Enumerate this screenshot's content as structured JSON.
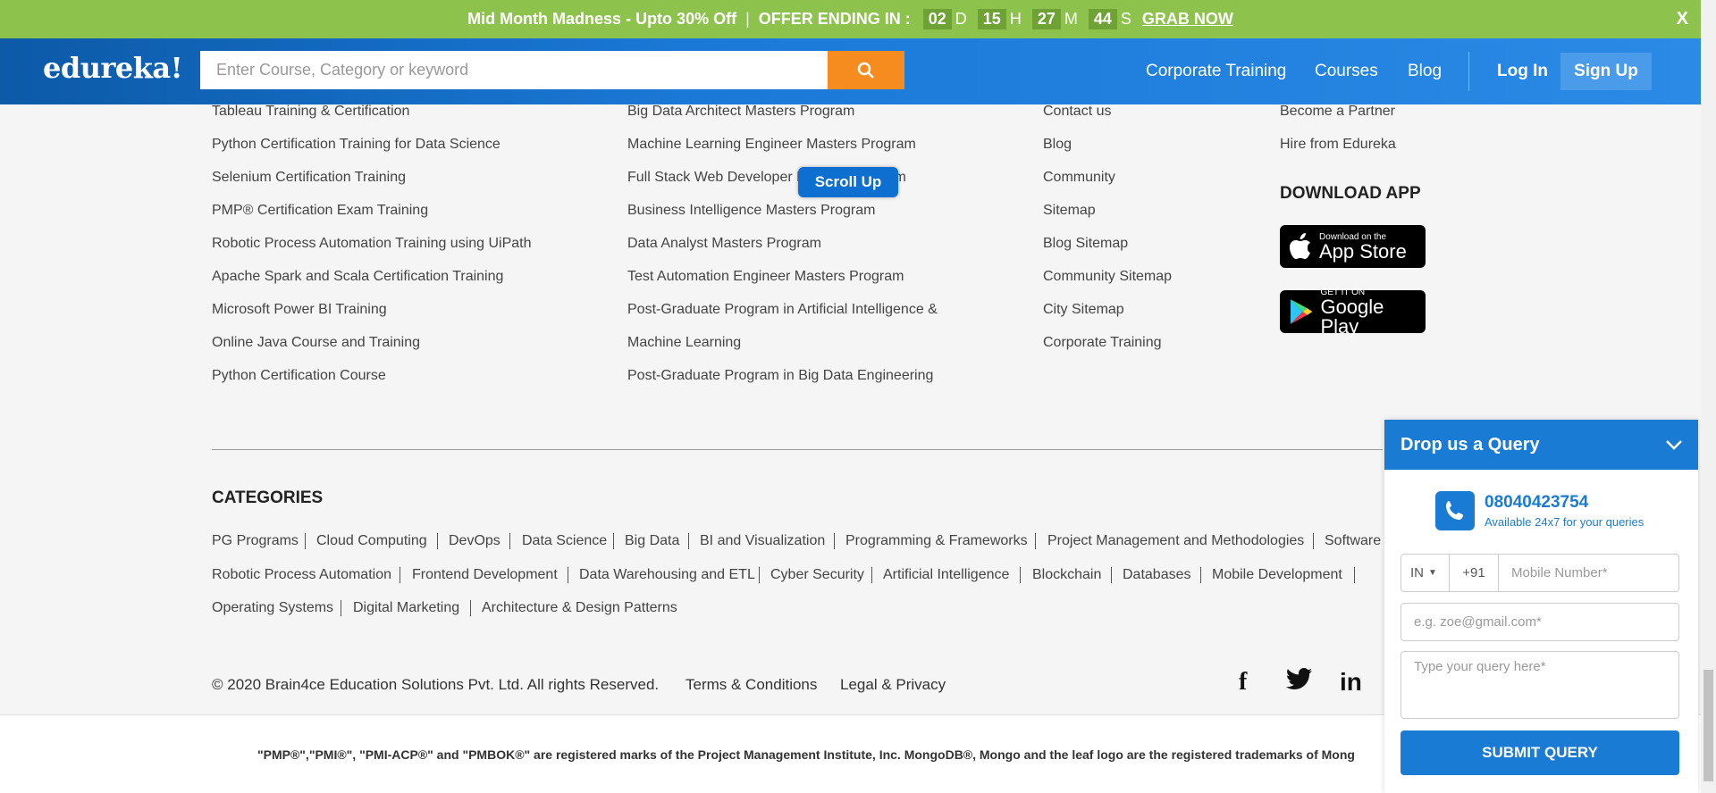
{
  "promo": {
    "text": "Mid Month Madness - Upto 30% Off",
    "offer_label": "OFFER ENDING IN :",
    "days": "02",
    "days_unit": "D",
    "hours": "15",
    "hours_unit": "H",
    "minutes": "27",
    "minutes_unit": "M",
    "seconds": "44",
    "seconds_unit": "S",
    "cta": "GRAB NOW",
    "close": "X"
  },
  "header": {
    "logo": "edureka!",
    "search_placeholder": "Enter Course, Category or keyword",
    "nav": [
      "Corporate Training",
      "Courses",
      "Blog"
    ],
    "login": "Log In",
    "signup": "Sign Up"
  },
  "footer": {
    "col1": [
      "Tableau Training & Certification",
      "Python Certification Training for Data Science",
      "Selenium Certification Training",
      "PMP® Certification Exam Training",
      "Robotic Process Automation Training using UiPath",
      "Apache Spark and Scala Certification Training",
      "Microsoft Power BI Training",
      "Online Java Course and Training",
      "Python Certification Course"
    ],
    "col2": [
      "Big Data Architect Masters Program",
      "Machine Learning Engineer Masters Program",
      "Full Stack Web Developer Masters Program",
      "Business Intelligence Masters Program",
      "Data Analyst Masters Program",
      "Test Automation Engineer Masters Program",
      "Post-Graduate Program in Artificial Intelligence &",
      "Machine Learning",
      "Post-Graduate Program in Big Data Engineering"
    ],
    "col3": [
      "Contact us",
      "Blog",
      "Community",
      "Sitemap",
      "Blog Sitemap",
      "Community Sitemap",
      "City Sitemap",
      "Corporate Training"
    ],
    "col4": [
      "Become a Partner",
      "Hire from Edureka"
    ],
    "download_heading": "DOWNLOAD APP",
    "appstore_small": "Download on the",
    "appstore_big": "App Store",
    "play_small": "GET IT ON",
    "play_big": "Google Play",
    "scroll_up": "Scroll Up"
  },
  "categories": {
    "heading": "CATEGORIES",
    "row1": [
      "PG Programs",
      "Cloud Computing",
      "DevOps",
      "Data Science",
      "Big Data",
      "BI and Visualization",
      "Programming & Frameworks",
      "Project Management and Methodologies",
      "Software"
    ],
    "row2": [
      "Robotic Process Automation",
      "Frontend Development",
      "Data Warehousing and ETL",
      "Cyber Security",
      "Artificial Intelligence",
      "Blockchain",
      "Databases",
      "Mobile Development"
    ],
    "row3": [
      "Operating Systems",
      "Digital Marketing",
      "Architecture & Design Patterns"
    ]
  },
  "bottom": {
    "copyright": "© 2020 Brain4ce Education Solutions Pvt. Ltd. All rights Reserved.",
    "terms": "Terms & Conditions",
    "privacy": "Legal & Privacy",
    "social": [
      "f",
      "in"
    ],
    "legal": "\"PMP®\",\"PMI®\", \"PMI-ACP®\" and \"PMBOK®\" are registered marks of the Project Management Institute, Inc. MongoDB®, Mongo and the leaf logo are the registered trademarks of Mong"
  },
  "query": {
    "title": "Drop us a Query",
    "phone": "08040423754",
    "availability": "Available 24x7 for your queries",
    "country": "IN",
    "dial_code": "+91",
    "mobile_placeholder": "Mobile Number*",
    "email_placeholder": "e.g. zoe@gmail.com*",
    "query_placeholder": "Type your query here*",
    "submit": "SUBMIT QUERY"
  }
}
